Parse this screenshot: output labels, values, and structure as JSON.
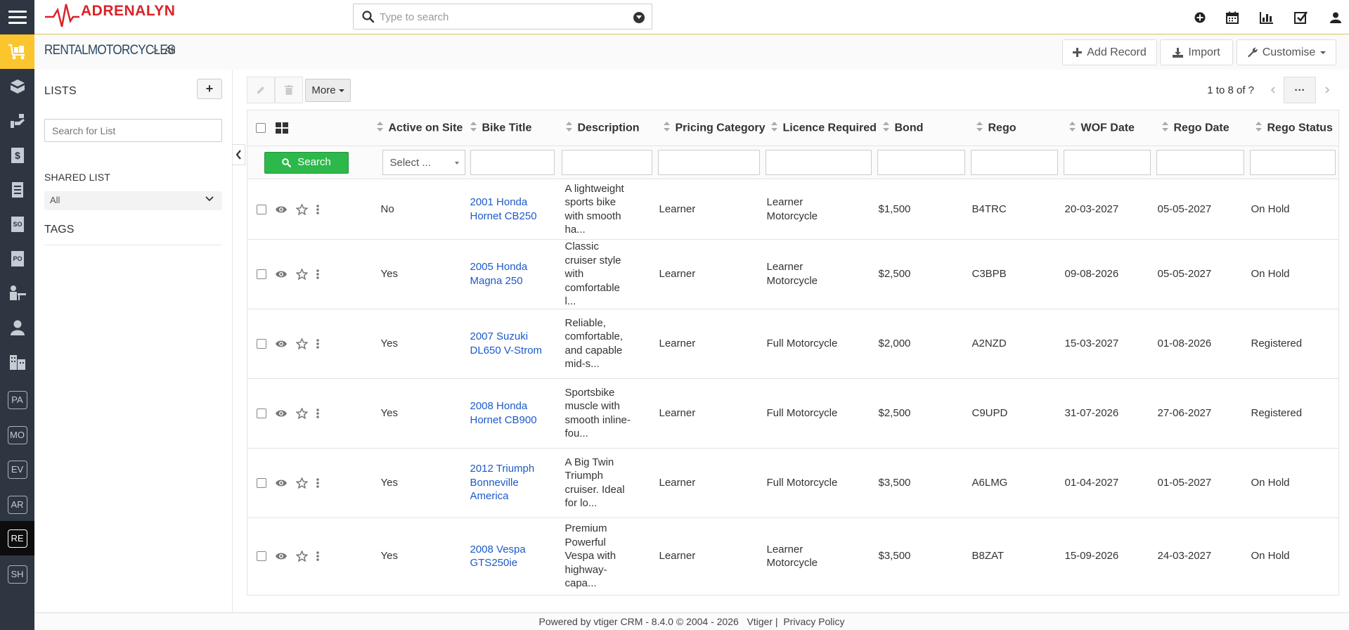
{
  "app": {
    "logo_text": "ADRENALYN",
    "search_placeholder": "Type to search"
  },
  "topbar_icons": [
    "plus-circle-icon",
    "calendar-icon",
    "bar-chart-icon",
    "checkbox-tasks-icon",
    "user-icon"
  ],
  "leftnav": {
    "icons": [
      "cart-module-icon",
      "box-module-icon",
      "hand-module-icon",
      "dollar-doc-icon",
      "doc-module-icon",
      "so-doc-icon",
      "po-doc-icon",
      "person-desk-icon",
      "contact-icon",
      "buildings-icon"
    ],
    "badges": [
      "PA",
      "MO",
      "EV",
      "AR",
      "RE",
      "SH"
    ],
    "active_badge": "RE"
  },
  "module": {
    "name": "RENTALMOTORCYCLES",
    "separator": ">",
    "view": "All",
    "add_record": "Add Record",
    "import": "Import",
    "customise": "Customise"
  },
  "lists_panel": {
    "title": "LISTS",
    "add_label": "+",
    "search_placeholder": "Search for List",
    "shared_title": "SHARED LIST",
    "shared_value": "All",
    "tags_title": "TAGS"
  },
  "list_actions": {
    "more": "More",
    "paging_text": "1 to 8  of ?",
    "dots": "···"
  },
  "table": {
    "columns": [
      "Active on Site",
      "Bike Title",
      "Description",
      "Pricing Category",
      "Licence Required",
      "Bond",
      "Rego",
      "WOF Date",
      "Rego Date",
      "Rego Status"
    ],
    "filter_select": "Select ...",
    "search_button": "Search",
    "rows": [
      {
        "active": "No",
        "title": "2001 Honda Hornet CB250",
        "desc": "A lightweight sports bike with smooth ha...",
        "pricing": "Learner",
        "licence": "Learner Motorcycle",
        "bond": "$1,500",
        "rego": "B4TRC",
        "wof": "20-03-2027",
        "rego_date": "05-05-2027",
        "status": "On Hold"
      },
      {
        "active": "Yes",
        "title": "2005 Honda Magna 250",
        "desc": "Classic cruiser style with comfortable l...",
        "pricing": "Learner",
        "licence": "Learner Motorcycle",
        "bond": "$2,500",
        "rego": "C3BPB",
        "wof": "09-08-2026",
        "rego_date": "05-05-2027",
        "status": "On Hold"
      },
      {
        "active": "Yes",
        "title": "2007 Suzuki DL650 V-Strom",
        "desc": "Reliable, comfortable, and capable mid-s...",
        "pricing": "Learner",
        "licence": "Full Motorcycle",
        "bond": "$2,000",
        "rego": "A2NZD",
        "wof": "15-03-2027",
        "rego_date": "01-08-2026",
        "status": "Registered"
      },
      {
        "active": "Yes",
        "title": "2008 Honda Hornet CB900",
        "desc": "Sportsbike muscle with smooth inline-fou...",
        "pricing": "Learner",
        "licence": "Full Motorcycle",
        "bond": "$2,500",
        "rego": "C9UPD",
        "wof": "31-07-2026",
        "rego_date": "27-06-2027",
        "status": "Registered"
      },
      {
        "active": "Yes",
        "title": "2012 Triumph Bonneville America",
        "desc": "A Big Twin Triumph cruiser. Ideal for lo...",
        "pricing": "Learner",
        "licence": "Full Motorcycle",
        "bond": "$3,500",
        "rego": "A6LMG",
        "wof": "01-04-2027",
        "rego_date": "01-05-2027",
        "status": "On Hold"
      },
      {
        "active": "Yes",
        "title": "2008 Vespa GTS250ie",
        "desc": "Premium Powerful Vespa with highway-capa...",
        "pricing": "Learner",
        "licence": "Learner Motorcycle",
        "bond": "$3,500",
        "rego": "B8ZAT",
        "wof": "15-09-2026",
        "rego_date": "24-03-2027",
        "status": "On Hold"
      }
    ]
  },
  "footer": {
    "powered": "Powered by vtiger CRM - 8.4.0  © 2004 - 2026",
    "vtiger": "Vtiger",
    "sep": "|",
    "privacy": "Privacy Policy"
  },
  "colors": {
    "nav_bg": "#2d3641",
    "active_module": "#fbc52d",
    "link": "#1c5ac8",
    "search_green": "#2db84b",
    "logo_red": "#d9232a"
  }
}
